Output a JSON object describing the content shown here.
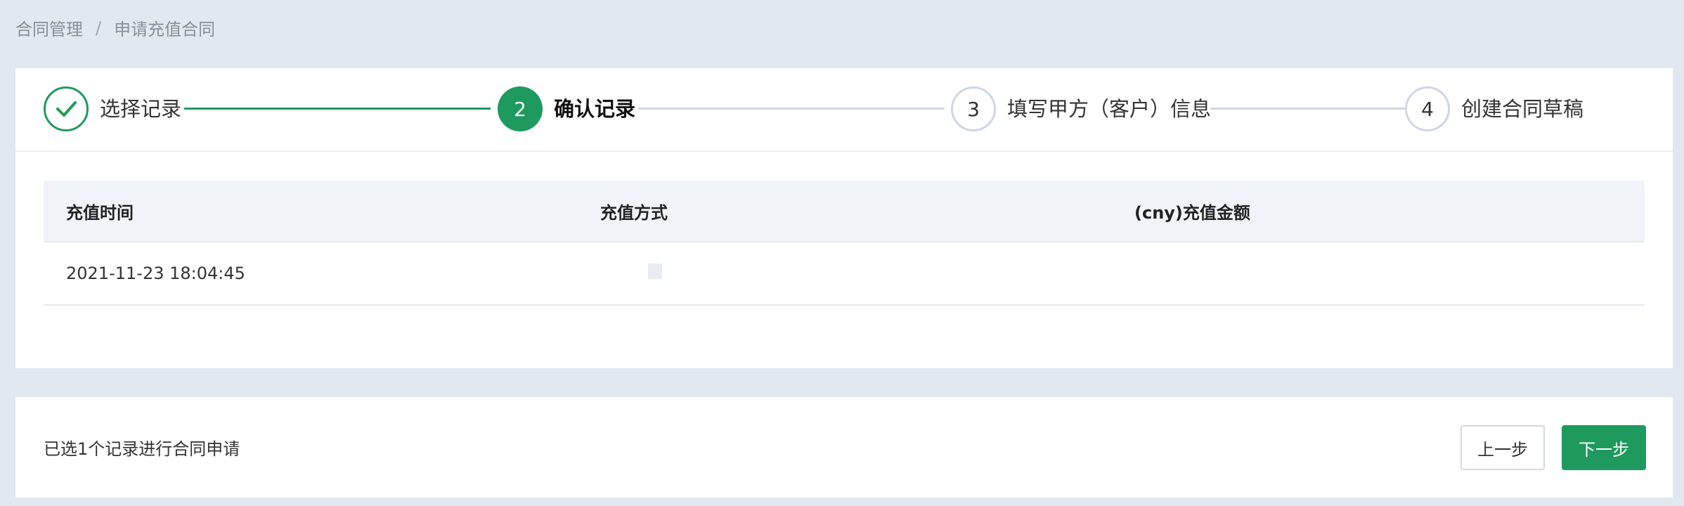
{
  "breadcrumb": {
    "items": [
      "合同管理",
      "申请充值合同"
    ],
    "separator": "/"
  },
  "steps": [
    {
      "number": "1",
      "label": "选择记录",
      "status": "done"
    },
    {
      "number": "2",
      "label": "确认记录",
      "status": "active"
    },
    {
      "number": "3",
      "label": "填写甲方（客户）信息",
      "status": "pending"
    },
    {
      "number": "4",
      "label": "创建合同草稿",
      "status": "pending"
    }
  ],
  "table": {
    "headers": [
      "充值时间",
      "充值方式",
      "(cny)充值金额"
    ],
    "rows": [
      [
        "2021-11-23 18:04:45",
        "",
        ""
      ]
    ]
  },
  "footer": {
    "summary": "已选1个记录进行合同申请",
    "prev_label": "上一步",
    "next_label": "下一步"
  },
  "colors": {
    "accent": "#1f9a5e",
    "background": "#e1e8ef"
  }
}
